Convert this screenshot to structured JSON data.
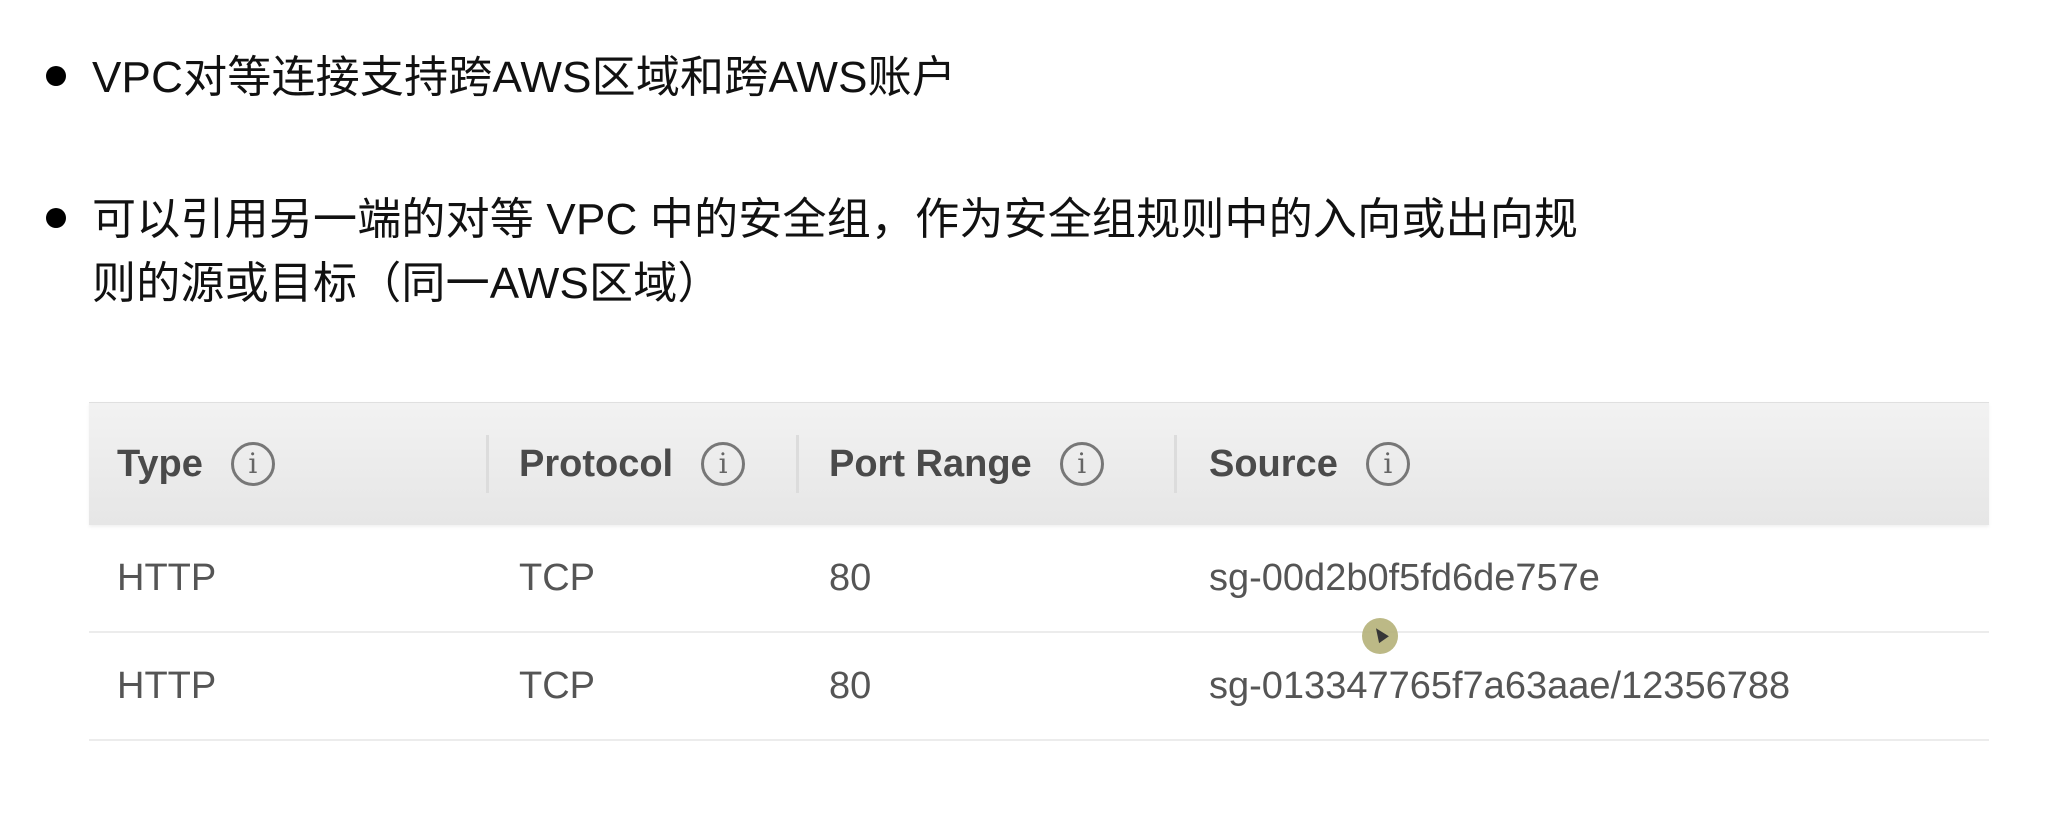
{
  "bullets": [
    {
      "text": "VPC对等连接支持跨AWS区域和跨AWS账户"
    },
    {
      "text": "可以引用另一端的对等 VPC 中的安全组，作为安全组规则中的入向或出向规则的源或目标（同一AWS区域）"
    }
  ],
  "table": {
    "columns": [
      {
        "label": "Type",
        "icon": "info-icon"
      },
      {
        "label": "Protocol",
        "icon": "info-icon"
      },
      {
        "label": "Port Range",
        "icon": "info-icon"
      },
      {
        "label": "Source",
        "icon": "info-icon"
      }
    ],
    "info_glyph": "i",
    "rows": [
      {
        "type": "HTTP",
        "protocol": "TCP",
        "port_range": "80",
        "source": "sg-00d2b0f5fd6de757e"
      },
      {
        "type": "HTTP",
        "protocol": "TCP",
        "port_range": "80",
        "source": "sg-013347765f7a63aae/12356788"
      }
    ]
  },
  "colors": {
    "header_bg": "#e9e9e9",
    "header_text": "#4a4a4a",
    "cell_text": "#555555",
    "cursor_highlight": "#b5b27a"
  }
}
